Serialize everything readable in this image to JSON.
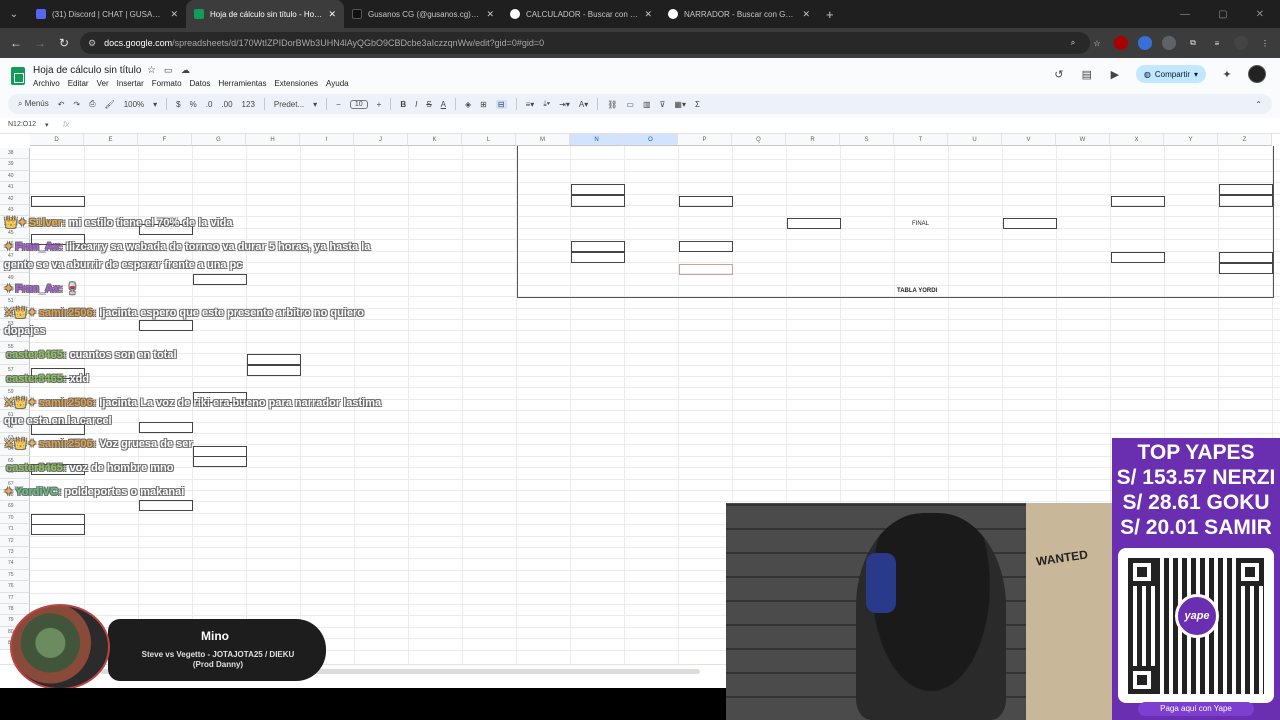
{
  "browser": {
    "tabs": [
      {
        "title": "(31) Discord | CHAT | GUSANOS",
        "color": "#5865f2",
        "active": false
      },
      {
        "title": "Hoja de cálculo sin título - Hojas de cálculo de Google",
        "color": "#0f9d58",
        "active": true
      },
      {
        "title": "Gusanos CG (@gusanos.cg) | TikTok",
        "color": "#111111",
        "active": false
      },
      {
        "title": "CALCULADOR - Buscar con Google",
        "color": "#4285f4",
        "active": false
      },
      {
        "title": "NARRADOR - Buscar con Google",
        "color": "#4285f4",
        "active": false
      }
    ],
    "url_host": "docs.google.com",
    "url_path": "/spreadsheets/d/170WtIZPIDorBWb3UHN4lAyQGbO9CBDcbe3aIczzqnWw/edit?gid=0#gid=0"
  },
  "sheets": {
    "title": "Hoja de cálculo sin título",
    "menu": [
      "Archivo",
      "Editar",
      "Ver",
      "Insertar",
      "Formato",
      "Datos",
      "Herramientas",
      "Extensiones",
      "Ayuda"
    ],
    "share_label": "Compartir",
    "toolbar": {
      "menus": "Menús",
      "zoom": "100%",
      "currency": "$",
      "percent": "%",
      "dec_minus": ".0",
      "dec_plus": ".00",
      "numfmt": "123",
      "font": "Predet...",
      "font_size": "10"
    },
    "namebox": "N12:O12",
    "fx": "fx",
    "columns": [
      "D",
      "E",
      "F",
      "G",
      "H",
      "I",
      "J",
      "K",
      "L",
      "M",
      "N",
      "O",
      "P",
      "Q",
      "R",
      "S",
      "T",
      "U",
      "V",
      "W",
      "X",
      "Y",
      "Z"
    ],
    "selected_columns": [
      "N",
      "O"
    ],
    "rows": [
      "38",
      "39",
      "40",
      "41",
      "42",
      "43",
      "44",
      "45",
      "46",
      "47",
      "48",
      "49",
      "50",
      "51",
      "52",
      "53",
      "54",
      "55",
      "56",
      "57",
      "58",
      "59",
      "60",
      "61",
      "62",
      "63",
      "64",
      "65",
      "66",
      "67",
      "68",
      "69",
      "70",
      "71",
      "72",
      "73",
      "74",
      "75",
      "76",
      "77",
      "78",
      "79",
      "80",
      "81"
    ],
    "label_final": "FINAL",
    "label_tabla": "TABLA YORDI"
  },
  "chat": [
    {
      "badges": "👑✦",
      "user": "S1lver:",
      "user_color": "#e8a020",
      "text": "mi estilo tiene el 70% de la vida"
    },
    {
      "badges": "✦",
      "user": "Fran_Ax:",
      "user_color": "#a040e0",
      "text": "Ilizcarry sa webada de torneo va durar 5 horas, ya hasta la gente se va aburrir de esperar frente a una pc"
    },
    {
      "badges": "✦",
      "user": "Fran_Ax:",
      "user_color": "#a040e0",
      "text": "🍷"
    },
    {
      "badges": "⚔👑✦",
      "user": "samir2506:",
      "user_color": "#e09020",
      "text": "Ijacinta espero que este presente arbitro no quiero dopajes"
    },
    {
      "badges": "",
      "user": "caster8465:",
      "user_color": "#7ac040",
      "text": "cuantos son en total"
    },
    {
      "badges": "",
      "user": "caster8465:",
      "user_color": "#7ac040",
      "text": "xdd"
    },
    {
      "badges": "⚔👑✦",
      "user": "samir2506:",
      "user_color": "#e09020",
      "text": "Ijacinta La voz de riki era bueno para narrador lastima que esta en la carcel"
    },
    {
      "badges": "⚔👑✦",
      "user": "samir2506:",
      "user_color": "#e09020",
      "text": "Voz gruesa de ser"
    },
    {
      "badges": "",
      "user": "caster8465:",
      "user_color": "#7ac040",
      "text": "voz de hombre mno"
    },
    {
      "badges": "✦",
      "user": "YordiVC:",
      "user_color": "#40c070",
      "text": "poldeportes o makanai"
    }
  ],
  "now_playing": {
    "title": "Mino",
    "subtitle": "Steve vs Vegetto - JOTAJOTA25 / DIEKU (Prod Danny)"
  },
  "yapes": {
    "title": "TOP YAPES",
    "entries": [
      "S/ 153.57 NERZI",
      "S/ 28.61 GOKU",
      "S/ 20.01 SAMIR"
    ],
    "qr_logo": "yape",
    "pay_label": "Paga aquí con Yape"
  },
  "webcam": {
    "poster_text": "WANTED"
  }
}
